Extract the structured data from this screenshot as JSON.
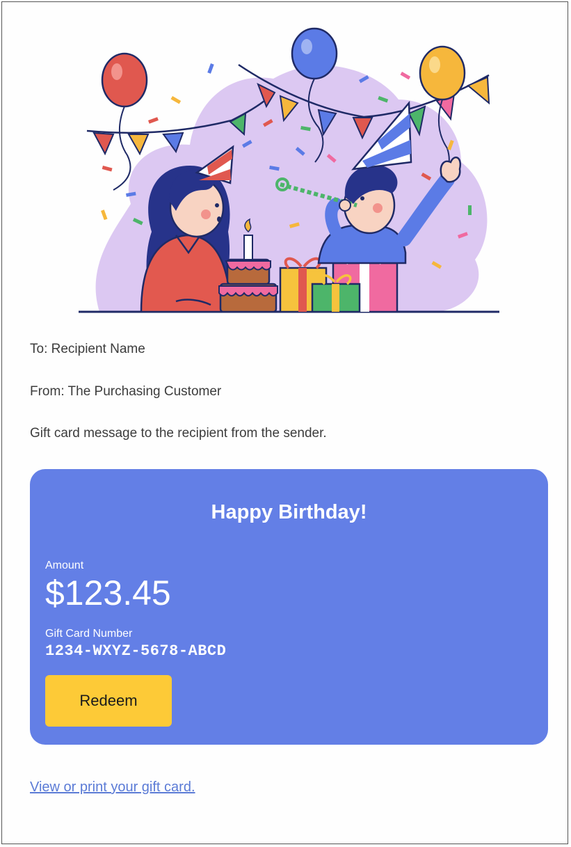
{
  "recipient": {
    "to_line": "To: Recipient Name"
  },
  "sender": {
    "from_line": "From: The Purchasing Customer"
  },
  "message": {
    "text": "Gift card message to the recipient from the sender."
  },
  "card": {
    "title": "Happy Birthday!",
    "amount_label": "Amount",
    "amount_value": "$123.45",
    "number_label": "Gift Card Number",
    "number_value": "1234-WXYZ-5678-ABCD",
    "redeem_label": "Redeem",
    "background_color": "#637fe6",
    "button_color": "#fdca37"
  },
  "footer": {
    "link_text": "View or print your gift card."
  }
}
